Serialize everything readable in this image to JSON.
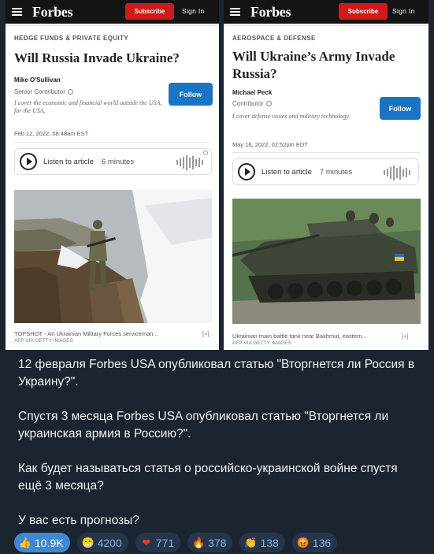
{
  "screenshots": [
    {
      "brand": "Forbes",
      "subscribe_label": "Subscribe",
      "signin_label": "Sign In",
      "section": "HEDGE FUNDS & PRIVATE EQUITY",
      "title": "Will Russia Invade Ukraine?",
      "author": "Mike O'Sullivan",
      "role": "Senior Contributor",
      "bio": "I cover the economic and financial world outside the USA, for the USA.",
      "follow_label": "Follow",
      "date": "Feb 12, 2022, 08:48am EST",
      "listen_label": "Listen to article",
      "duration": "6 minutes",
      "caption": "TOPSHOT - An Ukrainian Military Forces serviceman...",
      "expand": "[+]",
      "credit": "AFP VIA GETTY IMAGES"
    },
    {
      "brand": "Forbes",
      "subscribe_label": "Subscribe",
      "signin_label": "Sign In",
      "section": "AEROSPACE & DEFENSE",
      "title": "Will Ukraine’s Army Invade Russia?",
      "author": "Michael Peck",
      "role": "Contributor",
      "bio": "I cover defense issues and military technology.",
      "follow_label": "Follow",
      "date": "May 16, 2022, 02:52pm EDT",
      "listen_label": "Listen to article",
      "duration": "7 minutes",
      "caption": "Ukrainian main battle tank near Bakhmut, eastern...",
      "expand": "[+]",
      "credit": "AFP VIA GETTY IMAGES"
    }
  ],
  "message": {
    "p1": "12 февраля Forbes USA опубликовал статью \"Вторгнется ли Россия в Украину?\".",
    "p2": "Спустя 3 месяца Forbes USA опубликовал статью \"Вторгнется ли украинская армия в Россию?\".",
    "p3": "Как будет называться статья о российско-украинской войне спустя ещё 3 месяца?",
    "p4": "У вас есть прогнозы?"
  },
  "reactions": [
    {
      "icon": "thumbs-up-icon",
      "emoji": "👍",
      "count": "10.9K",
      "active": true
    },
    {
      "icon": "grinning-face-icon",
      "emoji": "😁",
      "count": "4200"
    },
    {
      "icon": "heart-icon",
      "emoji": "❤",
      "count": "771"
    },
    {
      "icon": "fire-icon",
      "emoji": "🔥",
      "count": "378"
    },
    {
      "icon": "clapping-hands-icon",
      "emoji": "👏",
      "count": "138"
    },
    {
      "icon": "angry-face-icon",
      "emoji": "😡",
      "count": "136"
    }
  ],
  "colors": {
    "background": "#1b2431",
    "forbes_red": "#d11a1a",
    "follow_blue": "#1a74c4",
    "reaction_active": "#3e88d4",
    "reaction_bg": "#26364a"
  }
}
